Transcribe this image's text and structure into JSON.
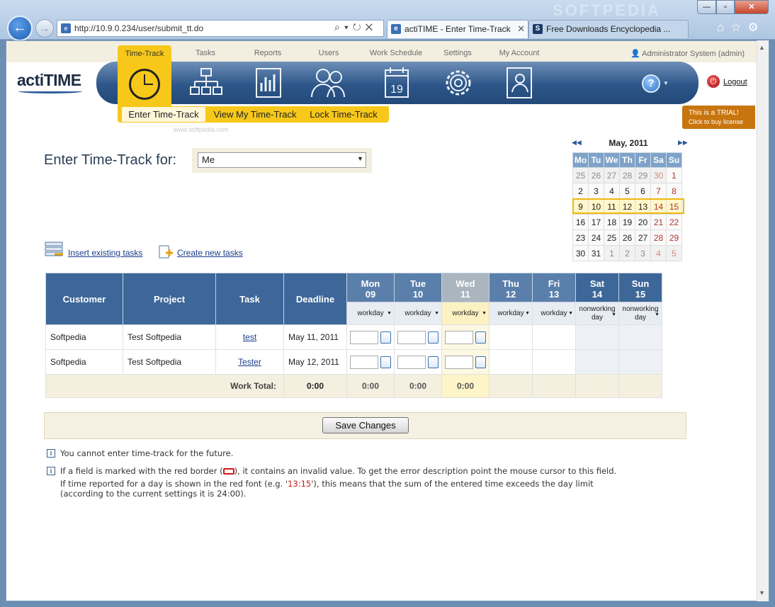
{
  "browser": {
    "address": "http://10.9.0.234/user/submit_tt.do",
    "tabs": [
      {
        "label": "actiTIME - Enter Time-Track"
      },
      {
        "label": "Free Downloads Encyclopedia ..."
      }
    ],
    "watermark": "SOFTPEDIA",
    "window_buttons": {
      "minimize": "—",
      "maximize": "▫",
      "close": "✕"
    }
  },
  "app": {
    "logo": "actiTIME",
    "user_info": "Administrator System (admin)",
    "logout": "Logout",
    "trial_line1": "This is a TRIAL!",
    "trial_line2": "Click to buy license",
    "help": "?"
  },
  "nav": {
    "tabs": [
      {
        "label": "Time-Track",
        "icon": "clock-icon"
      },
      {
        "label": "Tasks",
        "icon": "hierarchy-icon"
      },
      {
        "label": "Reports",
        "icon": "bar-chart-icon"
      },
      {
        "label": "Users",
        "icon": "users-icon"
      },
      {
        "label": "Work Schedule",
        "icon": "calendar-icon"
      },
      {
        "label": "Settings",
        "icon": "gear-icon"
      },
      {
        "label": "My Account",
        "icon": "account-card-icon"
      }
    ],
    "subtabs": [
      "Enter Time-Track",
      "View My Time-Track",
      "Lock Time-Track"
    ],
    "sub_watermark": "www.softpedia.com"
  },
  "enter_for": {
    "label": "Enter Time-Track for:",
    "value": "Me"
  },
  "calendar": {
    "month": "May, 2011",
    "weekdays": [
      "Mo",
      "Tu",
      "We",
      "Th",
      "Fr",
      "Sa",
      "Su"
    ],
    "weeks": [
      [
        "25",
        "26",
        "27",
        "28",
        "29",
        "30",
        "1"
      ],
      [
        "2",
        "3",
        "4",
        "5",
        "6",
        "7",
        "8"
      ],
      [
        "9",
        "10",
        "11",
        "12",
        "13",
        "14",
        "15"
      ],
      [
        "16",
        "17",
        "18",
        "19",
        "20",
        "21",
        "22"
      ],
      [
        "23",
        "24",
        "25",
        "26",
        "27",
        "28",
        "29"
      ],
      [
        "30",
        "31",
        "1",
        "2",
        "3",
        "4",
        "5"
      ]
    ]
  },
  "actions": {
    "insert": "Insert existing tasks",
    "create": "Create new tasks"
  },
  "grid": {
    "headers": {
      "customer": "Customer",
      "project": "Project",
      "task": "Task",
      "deadline": "Deadline"
    },
    "days": [
      {
        "name": "Mon",
        "num": "09",
        "type": "workday"
      },
      {
        "name": "Tue",
        "num": "10",
        "type": "workday"
      },
      {
        "name": "Wed",
        "num": "11",
        "type": "workday"
      },
      {
        "name": "Thu",
        "num": "12",
        "type": "workday"
      },
      {
        "name": "Fri",
        "num": "13",
        "type": "workday"
      },
      {
        "name": "Sat",
        "num": "14",
        "type": "nonworking day"
      },
      {
        "name": "Sun",
        "num": "15",
        "type": "nonworking day"
      }
    ],
    "rows": [
      {
        "customer": "Softpedia",
        "project": "Test Softpedia",
        "task": "test",
        "deadline": "May 11, 2011"
      },
      {
        "customer": "Softpedia",
        "project": "Test Softpedia",
        "task": "Tester",
        "deadline": "May 12, 2011"
      }
    ],
    "total": {
      "label": "Work Total:",
      "value": "0:00",
      "mon": "0:00",
      "tue": "0:00",
      "wed": "0:00"
    }
  },
  "save": "Save Changes",
  "notes": {
    "n1": "You cannot enter time-track for the future.",
    "n2a": "If a field is marked with the red border (",
    "n2b": "), it contains an invalid value. To get the error description point the mouse cursor to this field.",
    "n3a": "If time reported for a day is shown in the red font (e.g. '",
    "n3time": "13:15",
    "n3b": "'), this means that the sum of the entered time exceeds the day limit",
    "n4": "(according to the current settings it is 24:00)."
  }
}
